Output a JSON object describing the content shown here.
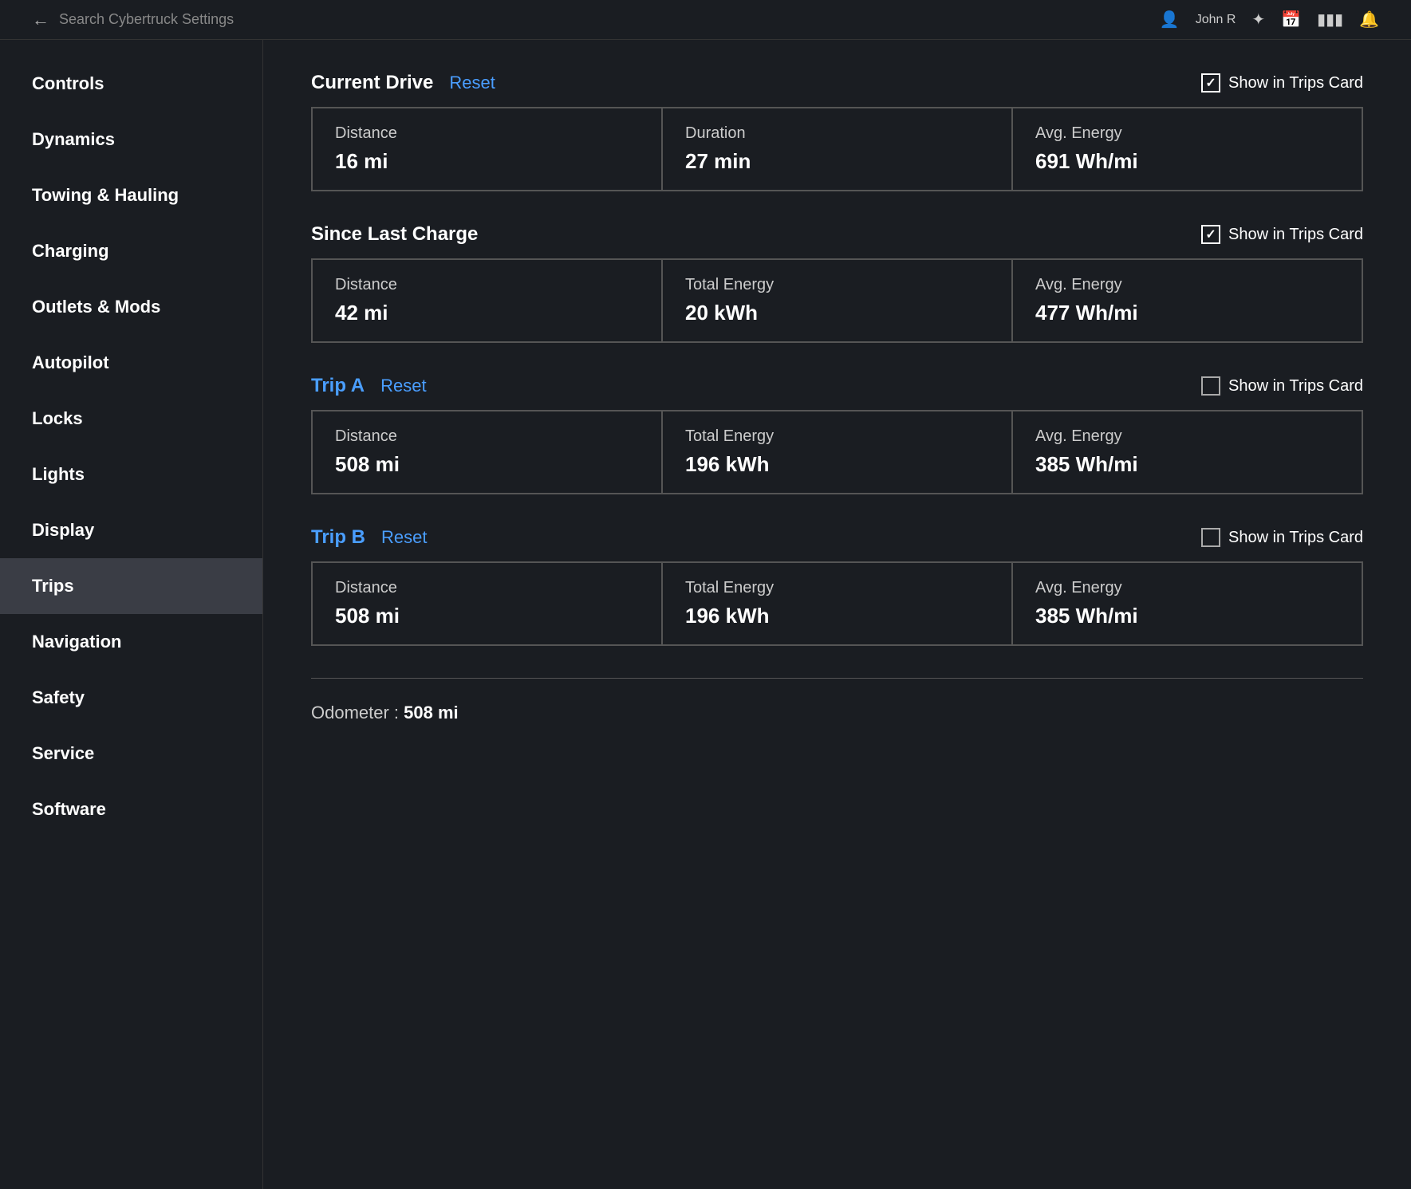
{
  "topbar": {
    "back_icon": "←",
    "search_placeholder": "Search Cybertruck Settings",
    "user_name": "John R",
    "bluetooth_icon": "bluetooth",
    "calendar_icon": "calendar",
    "signal_icon": "signal",
    "bell_icon": "bell"
  },
  "sidebar": {
    "items": [
      {
        "id": "controls",
        "label": "Controls"
      },
      {
        "id": "dynamics",
        "label": "Dynamics"
      },
      {
        "id": "towing",
        "label": "Towing & Hauling"
      },
      {
        "id": "charging",
        "label": "Charging"
      },
      {
        "id": "outlets",
        "label": "Outlets & Mods"
      },
      {
        "id": "autopilot",
        "label": "Autopilot"
      },
      {
        "id": "locks",
        "label": "Locks"
      },
      {
        "id": "lights",
        "label": "Lights"
      },
      {
        "id": "display",
        "label": "Display"
      },
      {
        "id": "trips",
        "label": "Trips",
        "active": true
      },
      {
        "id": "navigation",
        "label": "Navigation"
      },
      {
        "id": "safety",
        "label": "Safety"
      },
      {
        "id": "service",
        "label": "Service"
      },
      {
        "id": "software",
        "label": "Software"
      }
    ]
  },
  "current_drive": {
    "title": "Current Drive",
    "reset_label": "Reset",
    "show_in_trips_label": "Show in Trips Card",
    "show_checked": true,
    "distance_label": "Distance",
    "distance_value": "16 mi",
    "duration_label": "Duration",
    "duration_value": "27 min",
    "avg_energy_label": "Avg. Energy",
    "avg_energy_value": "691 Wh/mi"
  },
  "since_last_charge": {
    "title": "Since Last Charge",
    "show_in_trips_label": "Show in Trips Card",
    "show_checked": true,
    "distance_label": "Distance",
    "distance_value": "42 mi",
    "total_energy_label": "Total Energy",
    "total_energy_value": "20 kWh",
    "avg_energy_label": "Avg. Energy",
    "avg_energy_value": "477 Wh/mi"
  },
  "trip_a": {
    "title": "Trip A",
    "reset_label": "Reset",
    "show_in_trips_label": "Show in Trips Card",
    "show_checked": false,
    "distance_label": "Distance",
    "distance_value": "508 mi",
    "total_energy_label": "Total Energy",
    "total_energy_value": "196 kWh",
    "avg_energy_label": "Avg. Energy",
    "avg_energy_value": "385 Wh/mi"
  },
  "trip_b": {
    "title": "Trip B",
    "reset_label": "Reset",
    "show_in_trips_label": "Show in Trips Card",
    "show_checked": false,
    "distance_label": "Distance",
    "distance_value": "508 mi",
    "total_energy_label": "Total Energy",
    "total_energy_value": "196 kWh",
    "avg_energy_label": "Avg. Energy",
    "avg_energy_value": "385 Wh/mi"
  },
  "odometer": {
    "label": "Odometer :",
    "value": "508 mi"
  }
}
